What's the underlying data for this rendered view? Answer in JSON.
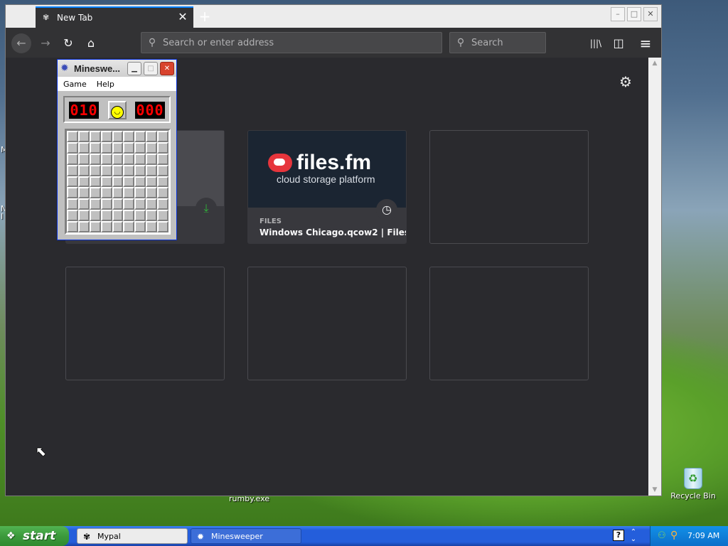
{
  "desktop": {
    "left_snippets": [
      "M",
      "N",
      "I"
    ],
    "recycle_bin_label": "Recycle Bin",
    "behind_window_label": "rumby.exe"
  },
  "browser": {
    "tab_title": "New Tab",
    "tab_close": "✕",
    "new_tab": "+",
    "window_buttons": {
      "minimize": "–",
      "maximize": "□",
      "close": "✕"
    },
    "address_placeholder": "Search or enter address",
    "search_placeholder": "Search",
    "nav_icons": {
      "back": "←",
      "forward": "→",
      "reload": "↻",
      "home": "⌂",
      "library": "|||\\",
      "sidebar": "◫",
      "menu": "≡"
    },
    "settings_icon": "⚙",
    "top_sites": [
      {
        "badge_icon": "⤓"
      },
      {
        "logo_text": "files.fm",
        "tagline": "cloud storage platform",
        "hostname": "FILES",
        "title": "Windows Chicago.qcow2 | Files...",
        "badge_icon": "◷"
      },
      {},
      {},
      {},
      {}
    ]
  },
  "minesweeper": {
    "title": "Mineswe...",
    "menu": [
      "Game",
      "Help"
    ],
    "mines_left": "010",
    "timer": "000",
    "rows": 9,
    "cols": 9
  },
  "taskbar": {
    "start_label": "start",
    "tasks": [
      "Mypal",
      "Minesweeper"
    ],
    "clock": "7:09 AM"
  }
}
